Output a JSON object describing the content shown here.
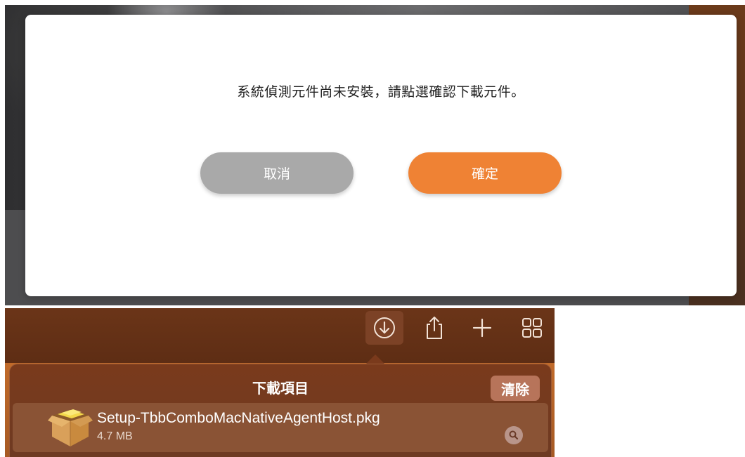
{
  "modal": {
    "message": "系統偵測元件尚未安裝，請點選確認下載元件。",
    "cancel_label": "取消",
    "confirm_label": "確定",
    "confirm_color": "#ef8234",
    "cancel_color": "#a9a9a9"
  },
  "toolbar": {
    "icons": [
      "download-icon",
      "share-icon",
      "plus-icon",
      "tab-overview-icon"
    ]
  },
  "downloads": {
    "title": "下載項目",
    "clear_label": "清除",
    "items": [
      {
        "filename": "Setup-TbbComboMacNativeAgentHost.pkg",
        "size": "4.7 MB",
        "icon": "package-icon"
      }
    ]
  }
}
